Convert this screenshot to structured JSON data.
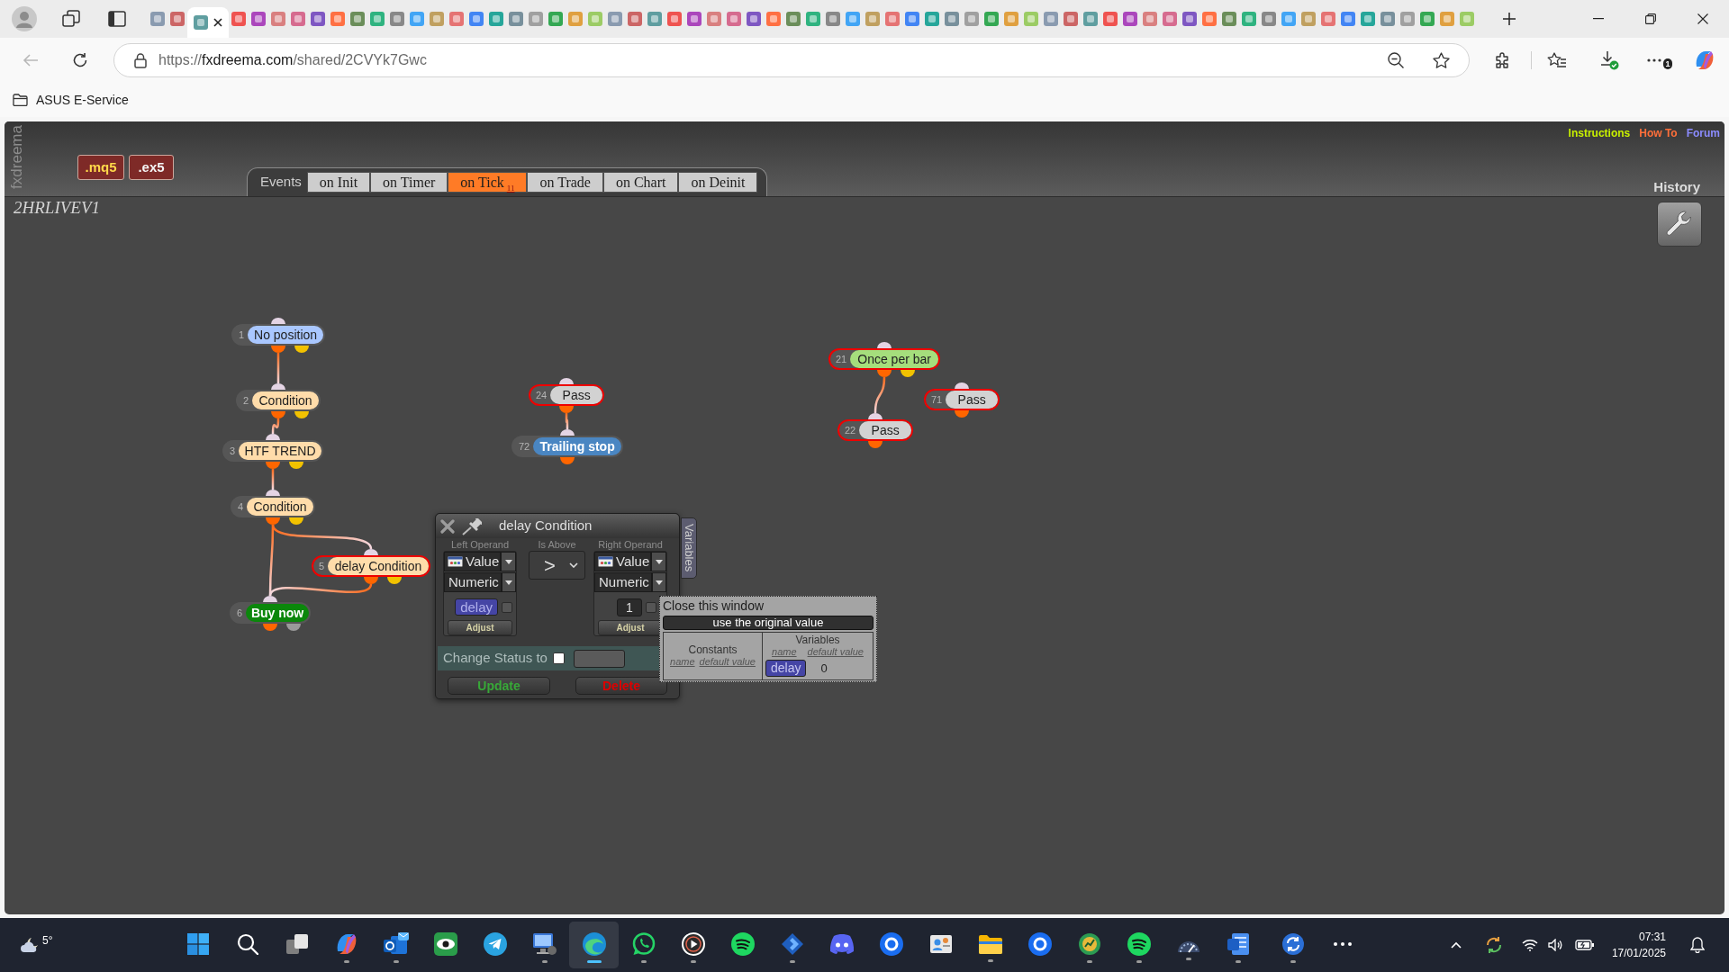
{
  "browser": {
    "tabs": [
      {
        "selected": false
      },
      {
        "selected": false
      },
      {
        "selected": true
      },
      {
        "selected": false
      },
      {
        "selected": false
      },
      {
        "selected": false
      },
      {
        "selected": false
      },
      {
        "selected": false
      },
      {
        "selected": false
      },
      {
        "selected": false
      },
      {
        "selected": false
      },
      {
        "selected": false
      },
      {
        "selected": false
      },
      {
        "selected": false
      },
      {
        "selected": false
      },
      {
        "selected": false
      },
      {
        "selected": false
      },
      {
        "selected": false
      },
      {
        "selected": false
      },
      {
        "selected": false
      },
      {
        "selected": false
      },
      {
        "selected": false
      },
      {
        "selected": false
      },
      {
        "selected": false
      },
      {
        "selected": false
      },
      {
        "selected": false
      },
      {
        "selected": false
      },
      {
        "selected": false
      },
      {
        "selected": false
      },
      {
        "selected": false
      },
      {
        "selected": false
      },
      {
        "selected": false
      },
      {
        "selected": false
      },
      {
        "selected": false
      },
      {
        "selected": false
      },
      {
        "selected": false
      },
      {
        "selected": false
      },
      {
        "selected": false
      },
      {
        "selected": false
      },
      {
        "selected": false
      },
      {
        "selected": false
      },
      {
        "selected": false
      },
      {
        "selected": false
      },
      {
        "selected": false
      },
      {
        "selected": false
      },
      {
        "selected": false
      },
      {
        "selected": false
      },
      {
        "selected": false
      },
      {
        "selected": false
      },
      {
        "selected": false
      },
      {
        "selected": false
      },
      {
        "selected": false
      },
      {
        "selected": false
      },
      {
        "selected": false
      },
      {
        "selected": false
      },
      {
        "selected": false
      },
      {
        "selected": false
      },
      {
        "selected": false
      },
      {
        "selected": false
      },
      {
        "selected": false
      },
      {
        "selected": false
      },
      {
        "selected": false
      },
      {
        "selected": false
      },
      {
        "selected": false
      },
      {
        "selected": false
      },
      {
        "selected": false
      }
    ],
    "address": {
      "scheme": "https://",
      "host": "fxdreema.com",
      "path": "/shared/2CVYk7Gwc"
    },
    "menu_badge": "1",
    "bookmarks": [
      {
        "label": "ASUS E-Service"
      }
    ]
  },
  "app": {
    "side_label": "fxdreema",
    "export_buttons": [
      {
        "label": ".mq5",
        "kind": "source"
      },
      {
        "label": ".ex5",
        "kind": "compiled"
      }
    ],
    "links": [
      {
        "label": "Instructions",
        "color": "#c8f000"
      },
      {
        "label": "How To",
        "color": "#ff6f3a"
      },
      {
        "label": "Forum",
        "color": "#8c8cff"
      }
    ],
    "events_label": "Events",
    "event_tabs": [
      {
        "label": "on Init",
        "selected": false
      },
      {
        "label": "on Timer",
        "selected": false
      },
      {
        "label": "on Tick",
        "count": "11",
        "selected": true
      },
      {
        "label": "on Trade",
        "selected": false
      },
      {
        "label": "on Chart",
        "selected": false
      },
      {
        "label": "on Deinit",
        "selected": false
      }
    ],
    "history": "History",
    "project_name": "2HRLIVEV1",
    "nodes": [
      {
        "number": "1",
        "label": "No position",
        "color": "#a9c7ff",
        "selected": false,
        "outputs": [
          {
            "color": "#ff6600"
          },
          {
            "color": "#f2c200"
          }
        ]
      },
      {
        "number": "2",
        "label": "Condition",
        "color": "#ffdcaa",
        "selected": false,
        "outputs": [
          {
            "color": "#ff6600"
          },
          {
            "color": "#f2c200"
          }
        ]
      },
      {
        "number": "3",
        "label": "HTF TREND",
        "color": "#ffdcaa",
        "selected": false,
        "outputs": [
          {
            "color": "#ff6600"
          },
          {
            "color": "#f2c200"
          }
        ]
      },
      {
        "number": "4",
        "label": "Condition",
        "color": "#ffdcaa",
        "selected": false,
        "outputs": [
          {
            "color": "#ff6600"
          },
          {
            "color": "#f2c200"
          }
        ]
      },
      {
        "number": "5",
        "label": "delay Condition",
        "color": "#ffdcaa",
        "selected": true,
        "outputs": [
          {
            "color": "#ff6600"
          },
          {
            "color": "#f2c200"
          }
        ]
      },
      {
        "number": "6",
        "label": "Buy now",
        "color": "#0b870b",
        "selected": false,
        "outputs": [
          {
            "color": "#ff6600"
          },
          {
            "color": "#9a9a9a"
          }
        ]
      },
      {
        "number": "24",
        "label": "Pass",
        "color": "#d2d2d2",
        "selected": true,
        "outputs": [
          {
            "color": "#ff6600"
          }
        ]
      },
      {
        "number": "72",
        "label": "Trailing stop",
        "color": "#4a86c2",
        "selected": false,
        "outputs": [
          {
            "color": "#ff6600"
          }
        ]
      },
      {
        "number": "21",
        "label": "Once per bar",
        "color": "#a5de7c",
        "selected": true,
        "outputs": [
          {
            "color": "#ff6600"
          },
          {
            "color": "#f2c200"
          }
        ]
      },
      {
        "number": "71",
        "label": "Pass",
        "color": "#d2d2d2",
        "selected": true,
        "outputs": [
          {
            "color": "#ff6600"
          }
        ]
      },
      {
        "number": "22",
        "label": "Pass",
        "color": "#d2d2d2",
        "selected": true,
        "outputs": [
          {
            "color": "#ff6600"
          }
        ]
      }
    ]
  },
  "dialog": {
    "title": "delay Condition",
    "side_tab": "Variables",
    "left": {
      "heading": "Left Operand",
      "source": "Value",
      "type": "Numeric",
      "variable": "delay",
      "checked": false,
      "button": "Adjust"
    },
    "operator": {
      "heading": "Is Above",
      "symbol": ">"
    },
    "right": {
      "heading": "Right Operand",
      "source": "Value",
      "type": "Numeric",
      "value": "1",
      "checked": false,
      "button": "Adjust"
    },
    "status": {
      "label": "Change Status to",
      "checked": false
    },
    "buttons": [
      {
        "label": "Update",
        "kind": "update"
      },
      {
        "label": "Delete",
        "kind": "delete"
      }
    ]
  },
  "popup": {
    "close": "Close this window",
    "reset": "use the original value",
    "constants": {
      "heading": "Constants",
      "columns": [
        "name",
        "default value"
      ]
    },
    "variables": {
      "heading": "Variables",
      "columns": [
        "name",
        "default value"
      ],
      "rows": [
        {
          "name": "delay",
          "value": "0"
        }
      ]
    }
  },
  "taskbar": {
    "weather": "5°",
    "apps": [
      {
        "running": false,
        "selected": false
      },
      {
        "running": false,
        "selected": false
      },
      {
        "running": false,
        "selected": false
      },
      {
        "running": true,
        "selected": false
      },
      {
        "running": true,
        "selected": false
      },
      {
        "running": false,
        "selected": false
      },
      {
        "running": false,
        "selected": false
      },
      {
        "running": true,
        "selected": false
      },
      {
        "running": true,
        "selected": true
      },
      {
        "running": true,
        "selected": false
      },
      {
        "running": true,
        "selected": false
      },
      {
        "running": false,
        "selected": false
      },
      {
        "running": true,
        "selected": false
      },
      {
        "running": false,
        "selected": false
      },
      {
        "running": false,
        "selected": false
      },
      {
        "running": false,
        "selected": false
      },
      {
        "running": true,
        "selected": false
      },
      {
        "running": false,
        "selected": false
      },
      {
        "running": true,
        "selected": false
      },
      {
        "running": true,
        "selected": false
      },
      {
        "running": true,
        "selected": false
      },
      {
        "running": true,
        "selected": false
      },
      {
        "running": true,
        "selected": false
      },
      {
        "running": false,
        "selected": false
      }
    ],
    "time": "07:31",
    "date": "17/01/2025"
  }
}
